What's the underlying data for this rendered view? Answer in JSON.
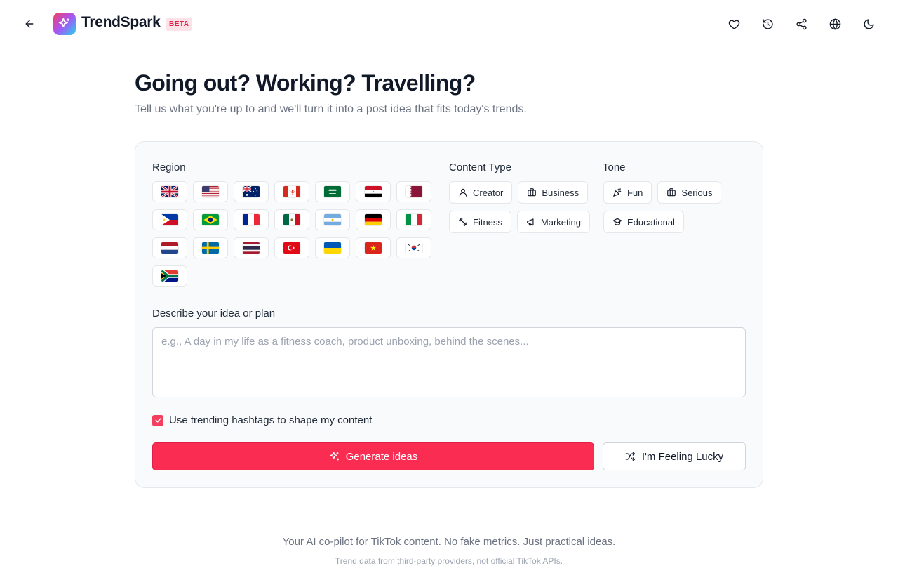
{
  "header": {
    "brand": "TrendSpark",
    "badge": "BETA"
  },
  "hero": {
    "title": "Going out? Working? Travelling?",
    "subtitle": "Tell us what you're up to and we'll turn it into a post idea that fits today's trends."
  },
  "form": {
    "region_label": "Region",
    "regions": [
      "United Kingdom",
      "United States",
      "Australia",
      "Canada",
      "Saudi Arabia",
      "Egypt",
      "Qatar",
      "Philippines",
      "Brazil",
      "France",
      "Mexico",
      "Argentina",
      "Germany",
      "Italy",
      "Netherlands",
      "Sweden",
      "Thailand",
      "Turkey",
      "Ukraine",
      "Vietnam",
      "South Korea",
      "South Africa"
    ],
    "content_type_label": "Content Type",
    "content_types": [
      "Creator",
      "Business",
      "Fitness",
      "Marketing"
    ],
    "tone_label": "Tone",
    "tones": [
      "Fun",
      "Serious",
      "Educational"
    ],
    "idea_label": "Describe your idea or plan",
    "idea_placeholder": "e.g., A day in my life as a fitness coach, product unboxing, behind the scenes...",
    "idea_value": "",
    "hashtags_label": "Use trending hashtags to shape my content",
    "hashtags_checked": true,
    "generate_label": "Generate ideas",
    "lucky_label": "I'm Feeling Lucky"
  },
  "footer": {
    "tagline": "Your AI co-pilot for TikTok content. No fake metrics. Just practical ideas.",
    "disclaimer": "Trend data from third-party providers, not official TikTok APIs."
  },
  "colors": {
    "accent": "#fb2c52",
    "badge_bg": "#fde2e7"
  }
}
